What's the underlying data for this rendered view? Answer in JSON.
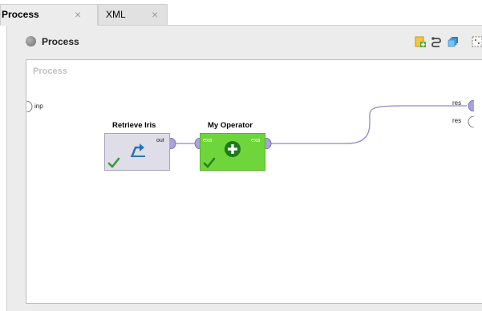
{
  "tabs": [
    {
      "label": "Process",
      "close": "×"
    },
    {
      "label": "XML",
      "close": "×"
    }
  ],
  "panel": {
    "title": "Process"
  },
  "toolbar": [
    "add-building-block-icon",
    "auto-wire-icon",
    "layers-icon",
    "grid-icon"
  ],
  "canvas": {
    "label": "Process",
    "input_port": "inp",
    "result_ports": [
      "res",
      "res"
    ]
  },
  "operators": {
    "retrieve": {
      "title": "Retrieve Iris",
      "out_port": "out",
      "icon": "retrieve-icon"
    },
    "my_operator": {
      "title": "My Operator",
      "in_port": "exa",
      "out_port": "exa",
      "icon": "plus-icon"
    }
  },
  "colors": {
    "operator_green": "#6ed63a",
    "operator_grey": "#dedde8",
    "port_purple": "#a9a3dd",
    "wire": "#8f86cf"
  }
}
